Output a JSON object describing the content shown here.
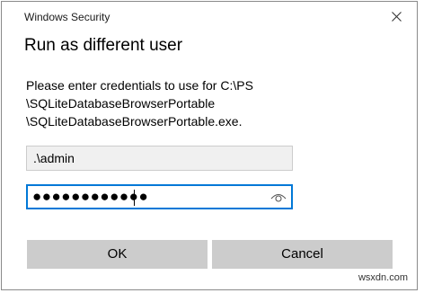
{
  "window": {
    "title": "Windows Security",
    "close_icon": "close-icon"
  },
  "dialog": {
    "heading": "Run as different user",
    "message_lines": [
      "Please enter credentials to use for C:\\PS",
      "\\SQLiteDatabaseBrowserPortable",
      "\\SQLiteDatabaseBrowserPortable.exe."
    ]
  },
  "fields": {
    "username_value": ".\\admin",
    "password_masked": "●●●●●●●●●●●●",
    "reveal_icon": "eye-icon"
  },
  "buttons": {
    "ok_label": "OK",
    "cancel_label": "Cancel"
  },
  "watermark": "wsxdn.com",
  "colors": {
    "accent": "#0078d7",
    "button_bg": "#cccccc",
    "readonly_field_bg": "#f0f0f0"
  }
}
